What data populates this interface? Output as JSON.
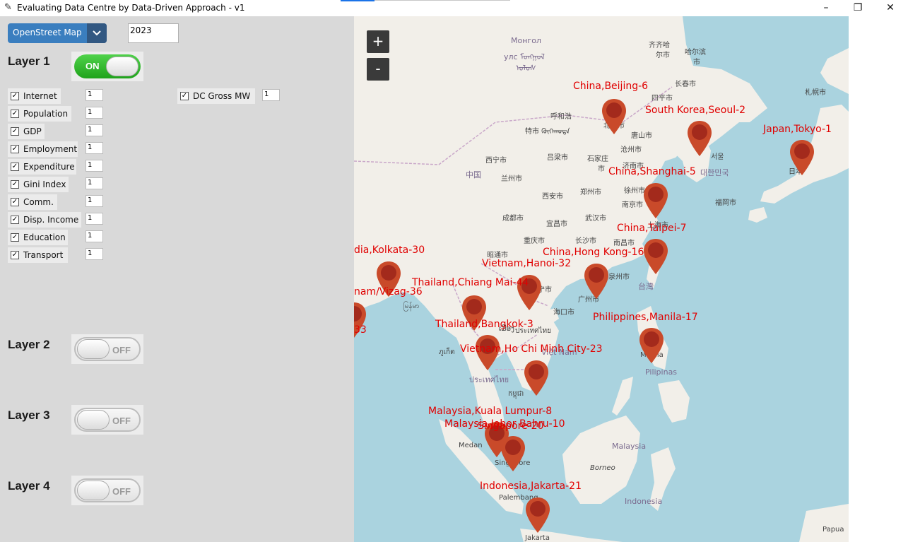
{
  "window": {
    "title": "Evaluating Data Centre by Data-Driven Approach - v1",
    "minimize": "–",
    "restore": "❐",
    "close": "✕"
  },
  "controls": {
    "map_source": "OpenStreet Map",
    "year": "2023"
  },
  "layers": [
    {
      "label": "Layer 1",
      "state": "ON"
    },
    {
      "label": "Layer 2",
      "state": "OFF"
    },
    {
      "label": "Layer 3",
      "state": "OFF"
    },
    {
      "label": "Layer 4",
      "state": "OFF"
    }
  ],
  "criteria": [
    {
      "label": "Internet",
      "checked": true,
      "weight": "1"
    },
    {
      "label": "Population",
      "checked": true,
      "weight": "1"
    },
    {
      "label": "GDP",
      "checked": true,
      "weight": "1"
    },
    {
      "label": "Employment",
      "checked": true,
      "weight": "1"
    },
    {
      "label": "Expenditure",
      "checked": true,
      "weight": "1"
    },
    {
      "label": "Gini Index",
      "checked": true,
      "weight": "1"
    },
    {
      "label": "Comm.",
      "checked": true,
      "weight": "1"
    },
    {
      "label": "Disp. Income",
      "checked": true,
      "weight": "1"
    },
    {
      "label": "Education",
      "checked": true,
      "weight": "1"
    },
    {
      "label": "Transport",
      "checked": true,
      "weight": "1"
    }
  ],
  "dc_gross": {
    "label": "DC Gross MW",
    "checked": true,
    "weight": "1"
  },
  "map": {
    "zoom_in": "+",
    "zoom_out": "-",
    "markers": [
      "China,Beijing-6",
      "South Korea,Seoul-2",
      "Japan,Tokyo-1",
      "China,Shanghai-5",
      "China,Taipei-7",
      "China,Hong Kong-16",
      "Vietnam,Hanoi-32",
      "dia,Kolkata-30",
      "Thailand,Chiang Mai-44",
      "nam/Vizag-36",
      "33",
      "Thailand,Bangkok-3",
      "Philippines,Manila-17",
      "Vietnam,Ho Chi Minh City-23",
      "Malaysia,Kuala Lumpur-8",
      "Malaysia,Johor Bahru-10",
      "Singapore-20",
      "Indonesia,Jakarta-21"
    ],
    "places": [
      "Монгол",
      "улс ᠮᠤᠩᠭᠤᠯ",
      "ᠤᠯᠤᠰ",
      "齐齐哈",
      "尔市",
      "哈尔滨",
      "市",
      "长春市",
      "札幌市",
      "呼和浩",
      "特市 ᠬᠥᠬᠡᠬᠣᠲᠠ",
      "北京市",
      "四平市",
      "唐山市",
      "沧州市",
      "石家庄",
      "市",
      "济南市",
      "西宁市",
      "吕梁市",
      "兰州市",
      "中国",
      "郑州市",
      "徐州市",
      "南京市",
      "上海市",
      "西安市",
      "成都市",
      "武汉市",
      "宜昌市",
      "重庆市",
      "长沙市",
      "南昌市",
      "福岡市",
      "昭通市",
      "宁市",
      "泉州市",
      "广州市",
      "海口市",
      "台灣",
      "서울",
      "대한민국",
      "日本",
      "Việt Nam",
      "Pilipinas",
      "Manila",
      "Medan",
      "Singapore",
      "Malaysia",
      "Borneo",
      "Palembang",
      "Indonesia",
      "Jakarta",
      "Papua",
      "ประเทศไทย",
      "កម្ពុជា",
      "ເມືອງ",
      "မြန်မာ",
      "ประเทศไทย",
      "ภูเก็ต"
    ]
  }
}
